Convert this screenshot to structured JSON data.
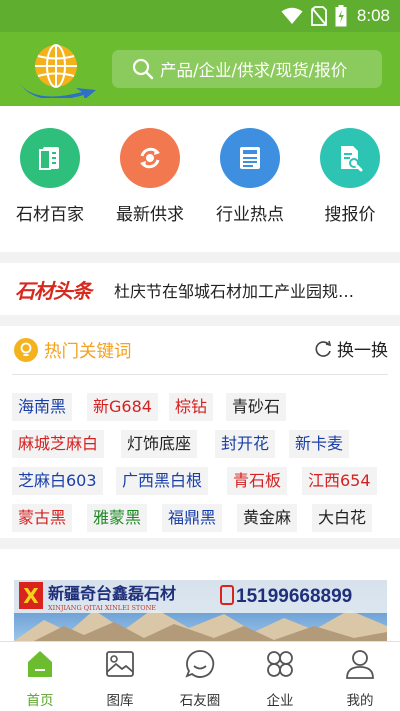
{
  "status_bar": {
    "time": "8:08"
  },
  "header": {
    "search_placeholder": "产品/企业/供求/现货/报价"
  },
  "quick_links": [
    {
      "label": "石材百家",
      "icon": "document-icon",
      "color": "#2fbf7c"
    },
    {
      "label": "最新供求",
      "icon": "exchange-icon",
      "color": "#f2784f"
    },
    {
      "label": "行业热点",
      "icon": "news-icon",
      "color": "#3e8fe0"
    },
    {
      "label": "搜报价",
      "icon": "search-doc-icon",
      "color": "#2ec4b4"
    }
  ],
  "headline": {
    "logo": "石材头条",
    "text": "杜庆节在邹城石材加工产业园规…"
  },
  "hot_keywords": {
    "title": "热门关键词",
    "refresh_label": "换一换",
    "tags": [
      [
        "海南黑",
        "新G684",
        "棕钻",
        "青砂石"
      ],
      [
        "麻城芝麻白",
        "灯饰底座",
        "封开花",
        "新卡麦"
      ],
      [
        "芝麻白603",
        "广西黑白根",
        "青石板",
        "江西654"
      ],
      [
        "蒙古黑",
        "雅蒙黑",
        "福鼎黑",
        "黄金麻",
        "大白花"
      ]
    ]
  },
  "banner": {
    "logo_letter": "X",
    "company": "新疆奇台鑫磊石材",
    "company_pinyin": "XINJIANG QITAI XINLEI STONE",
    "phone": "15199668899"
  },
  "bottom_nav": [
    {
      "label": "首页",
      "icon": "home-icon",
      "active": true
    },
    {
      "label": "图库",
      "icon": "gallery-icon",
      "active": false
    },
    {
      "label": "石友圈",
      "icon": "chat-icon",
      "active": false
    },
    {
      "label": "企业",
      "icon": "company-icon",
      "active": false
    },
    {
      "label": "我的",
      "icon": "profile-icon",
      "active": false
    }
  ],
  "colors": {
    "brand_green": "#6bbc2f",
    "status_green": "#60ae2f",
    "hot_orange": "#f4a21f",
    "headline_red": "#d72a1f"
  }
}
